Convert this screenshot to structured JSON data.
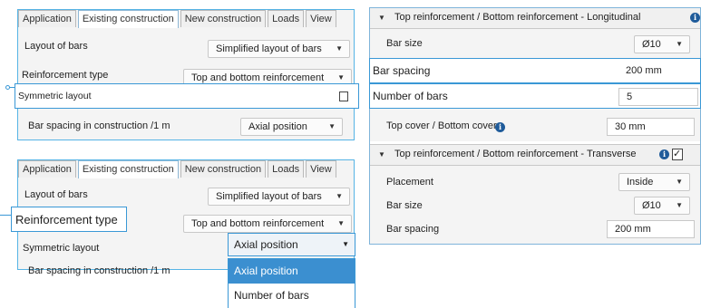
{
  "panel1": {
    "tabs": [
      "Application",
      "Existing construction",
      "New construction",
      "Loads",
      "View"
    ],
    "active_tab": 1,
    "rows": {
      "layout_label": "Layout of bars",
      "layout_value": "Simplified layout of bars",
      "reinf_label": "Reinforcement type",
      "reinf_value": "Top and bottom reinforcement",
      "sym_label": "Symmetric layout",
      "spacing_label": "Bar spacing in construction /1 m",
      "spacing_value": "Axial position"
    }
  },
  "panel2": {
    "tabs": [
      "Application",
      "Existing construction",
      "New construction",
      "Loads",
      "View"
    ],
    "active_tab": 1,
    "rows": {
      "layout_label": "Layout of bars",
      "layout_value": "Simplified layout of bars",
      "reinf_label": "Reinforcement type",
      "reinf_value": "Top and bottom reinforcement",
      "sym_label": "Symmetric layout",
      "spacing_label": "Bar spacing in construction /1 m",
      "spacing_value": "Axial position"
    },
    "dropdown_options": [
      "Axial position",
      "Number of bars"
    ],
    "selected_option": "Axial position"
  },
  "panel3": {
    "long_header": "Top reinforcement / Bottom reinforcement - Longitudinal",
    "bar_size_label": "Bar size",
    "bar_size_value": "Ø10",
    "bar_spacing_label": "Bar spacing",
    "bar_spacing_value": "200 mm",
    "num_bars_label": "Number of bars",
    "num_bars_value": "5",
    "cover_label": "Top cover / Bottom cover",
    "cover_value": "30 mm",
    "trans_header": "Top reinforcement / Bottom reinforcement - Transverse",
    "placement_label": "Placement",
    "placement_value": "Inside",
    "t_bar_size_label": "Bar size",
    "t_bar_size_value": "Ø10",
    "t_bar_spacing_label": "Bar spacing",
    "t_bar_spacing_value": "200 mm"
  },
  "icons": {
    "dropdown_arrow": "▼",
    "collapse_triangle": "▼",
    "info": "i",
    "checkmark": "✓"
  },
  "colors": {
    "highlight_border": "#3a98d6",
    "selected_item_bg": "#3b8fd0",
    "info_icon": "#1f5b9a"
  }
}
